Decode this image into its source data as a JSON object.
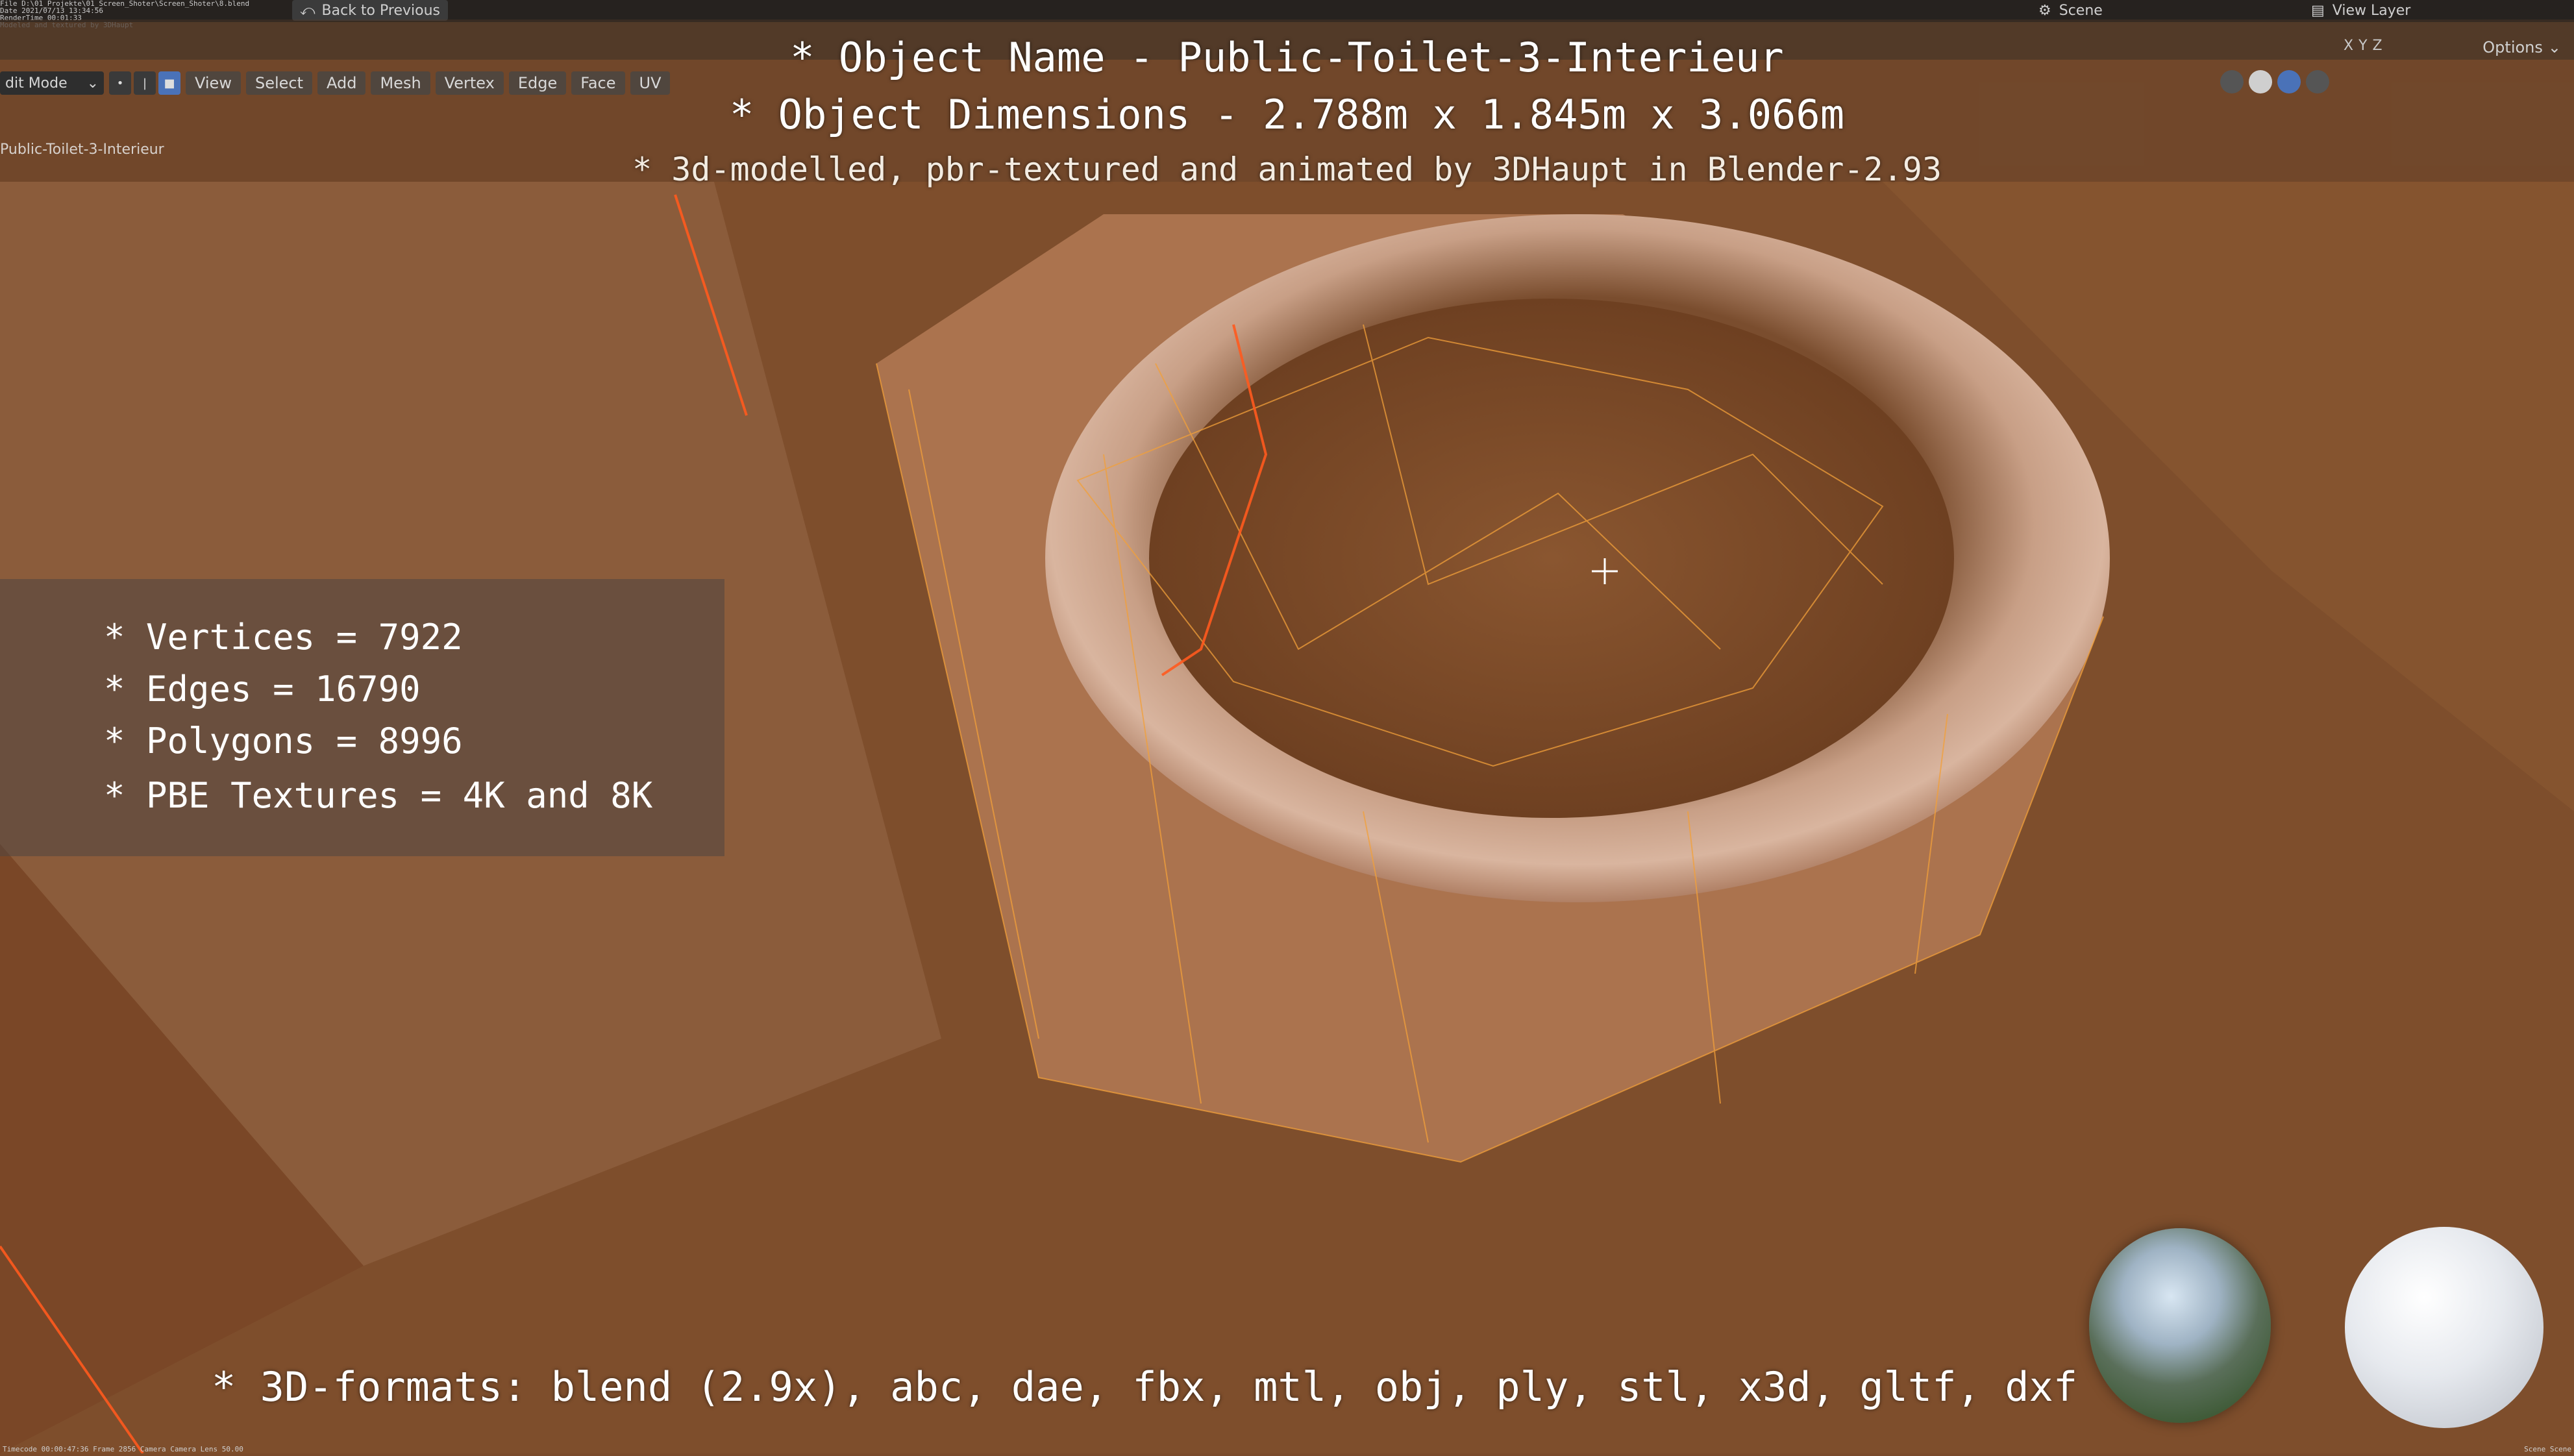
{
  "topbar": {
    "info_lines": "File D:\\01_Projekte\\01_Screen_Shoter\\Screen_Shoter\\8.blend\nDate 2021/07/13 13:34:56\nRenderTime 00:01:33\nModeled and textured by 3DHaupt",
    "back_label": "Back to Previous",
    "scene_label": "Scene",
    "view_layer_label": "View Layer"
  },
  "header": {
    "mode_label": "dit Mode",
    "menus": [
      "View",
      "Select",
      "Add",
      "Mesh",
      "Vertex",
      "Edge",
      "Face",
      "UV"
    ],
    "options_label": "Options",
    "axis_x": "X",
    "axis_y": "Y",
    "axis_z": "Z",
    "object_label": "Public-Toilet-3-Interieur"
  },
  "overlay": {
    "title_line1": "* Object Name - Public-Toilet-3-Interieur",
    "title_line2": "* Object Dimensions -  2.788m x 1.845m x 3.066m",
    "title_line3": "* 3d-modelled, pbr-textured and animated by 3DHaupt in Blender-2.93",
    "stats": {
      "vertices": "* Vertices = 7922",
      "edges": "* Edges = 16790",
      "polygons": "* Polygons = 8996",
      "textures": "* PBE Textures = 4K and 8K"
    },
    "formats": "* 3D-formats: blend (2.9x), abc, dae, fbx, mtl, obj, ply, stl, x3d, gltf, dxf"
  },
  "footer": {
    "left": "Timecode 00:00:47:36   Frame 2856   Camera Camera   Lens 50.00",
    "right": "Scene Scene"
  }
}
